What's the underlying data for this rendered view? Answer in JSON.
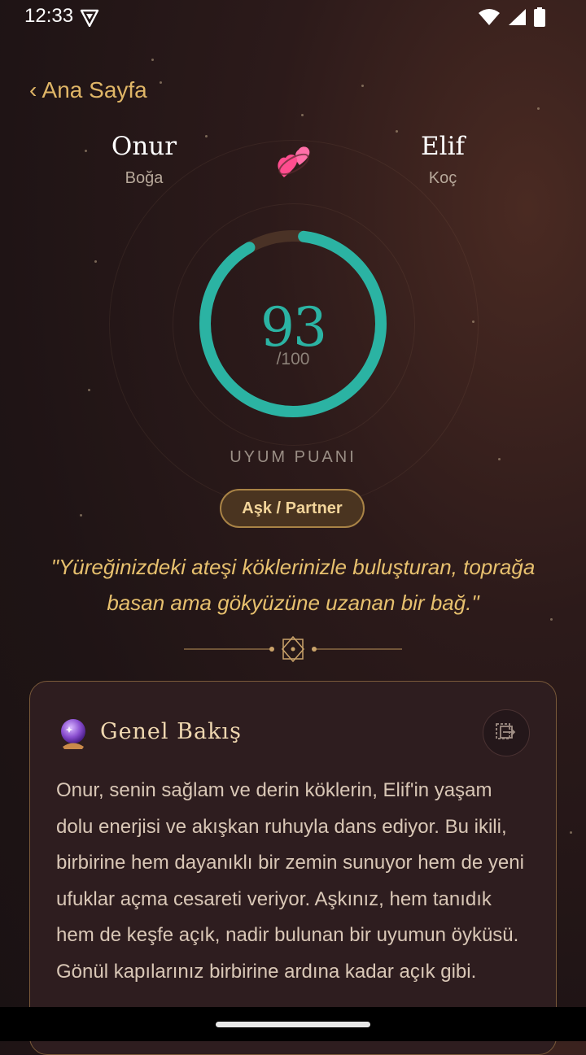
{
  "status_bar": {
    "time": "12:33",
    "icons": [
      "vpn-icon",
      "wifi-icon",
      "signal-icon",
      "battery-icon"
    ]
  },
  "header": {
    "back_label": "‹ Ana Sayfa"
  },
  "persons": {
    "left": {
      "name": "Onur",
      "sign": "Boğa"
    },
    "right": {
      "name": "Elif",
      "sign": "Koç"
    }
  },
  "hearts_emoji": "💞",
  "compatibility": {
    "score": "93",
    "max": "/100",
    "score_value": 93,
    "score_max_value": 100,
    "label": "UYUM PUANI"
  },
  "relation_chip": "Aşk / Partner",
  "quote": "\"Yüreğinizdeki ateşi köklerinizle buluşturan, toprağa basan ama gökyüzüne uzanan bir bağ.\"",
  "overview": {
    "icon": "🔮",
    "title": "Genel Bakış",
    "body": "Onur, senin sağlam ve derin köklerin, Elif'in yaşam dolu enerjisi ve akışkan ruhuyla dans ediyor. Bu ikili, birbirine hem dayanıklı bir zemin sunuyor hem de yeni ufuklar açma cesareti veriyor. Aşkınız, hem tanıdık hem de keşfe açık, nadir bulunan bir uyumun öyküsü. Gönül kapılarınız birbirine ardına kadar açık gibi."
  },
  "colors": {
    "accent_teal": "#2bb3a3",
    "gold": "#e0b667",
    "ring_track": "#4a3226"
  }
}
